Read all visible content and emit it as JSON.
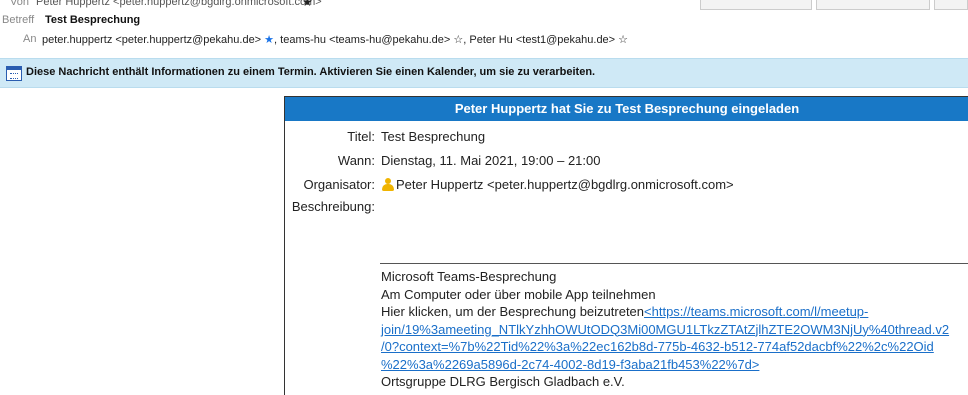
{
  "header": {
    "from_label": "Von",
    "from_value": "Peter Huppertz <peter.huppertz@bgdlrg.onmicrosoft.com>",
    "subject_label": "Betreff",
    "subject_value": "Test Besprechung",
    "to_label": "An",
    "to_recipients": [
      "peter.huppertz <peter.huppertz@pekahu.de>",
      "teams-hu <teams-hu@pekahu.de>",
      "Peter Hu <test1@pekahu.de>"
    ]
  },
  "banner": {
    "text": "Diese Nachricht enthält Informationen zu einem Termin. Aktivieren Sie einen Kalender, um sie zu verarbeiten."
  },
  "invite": {
    "header": "Peter Huppertz hat Sie zu Test Besprechung eingeladen",
    "title_label": "Titel:",
    "title_value": "Test Besprechung",
    "when_label": "Wann:",
    "when_value": "Dienstag, 11. Mai 2021, 19:00 – 21:00",
    "organizer_label": "Organisator:",
    "organizer_value": "Peter Huppertz <peter.huppertz@bgdlrg.onmicrosoft.com>",
    "description_label": "Beschreibung:",
    "description": {
      "line1": "Microsoft Teams-Besprechung",
      "line2": "Am Computer oder über mobile App teilnehmen",
      "line3_prefix": "Hier klicken, um der Besprechung beizutreten",
      "link_lines": [
        "<https://teams.microsoft.com/l/meetup-",
        "join/19%3ameeting_NTlkYzhhOWUtODQ3Mi00MGU1LTkzZTAtZjlhZTE2OWM3NjUy%40thread.v2",
        "/0?context=%7b%22Tid%22%3a%22ec162b8d-775b-4632-b512-774af52dacbf%22%2c%22Oid",
        "%22%3a%2269a5896d-2c74-4002-8d19-f3aba21fb453%22%7d>"
      ],
      "line_last": "Ortsgruppe DLRG Bergisch Gladbach e.V."
    }
  }
}
